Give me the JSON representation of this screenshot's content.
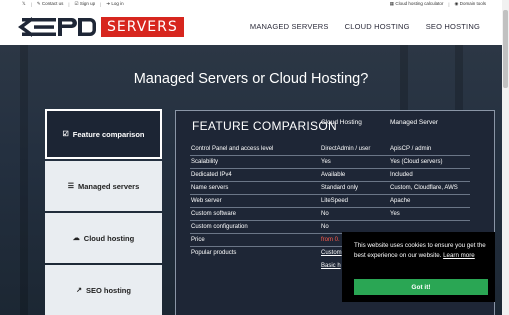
{
  "topbar": {
    "twitter_icon": "twitter-icon",
    "contact": "Contact us",
    "signup": "Sign up",
    "login": "Log in",
    "calculator": "Cloud hosting calculator",
    "domain_tools": "Domain tools"
  },
  "brand": {
    "servers_label": "SERVERS",
    "accent": "#d7261e"
  },
  "nav": {
    "items": [
      "MANAGED SERVERS",
      "CLOUD HOSTING",
      "SEO HOSTING"
    ]
  },
  "hero": {
    "title": "Managed Servers or Cloud Hosting?"
  },
  "tabs": [
    {
      "label": "Feature comparison",
      "icon": "checkbox-icon"
    },
    {
      "label": "Managed servers",
      "icon": "list-icon"
    },
    {
      "label": "Cloud hosting",
      "icon": "cloud-icon"
    },
    {
      "label": "SEO hosting",
      "icon": "chart-icon"
    }
  ],
  "comparison": {
    "title": "FEATURE COMPARISON",
    "columns": [
      "Cloud Hosting",
      "Managed Server"
    ],
    "rows": [
      [
        "Control Panel and access level",
        "DirectAdmin / user",
        "ApisCP / admin"
      ],
      [
        "Scalability",
        "Yes",
        "Yes (Cloud servers)"
      ],
      [
        "Dedicated IPv4",
        "Available",
        "Included"
      ],
      [
        "Name servers",
        "Standard only",
        "Custom, Cloudflare, AWS"
      ],
      [
        "Web server",
        "LiteSpeed",
        "Apache"
      ],
      [
        "Custom software",
        "No",
        "Yes"
      ],
      [
        "Custom configuration",
        "No",
        ""
      ],
      [
        "Price",
        "from 0.",
        ""
      ],
      [
        "Popular products",
        "Custom",
        ""
      ],
      [
        "",
        "Basic h",
        ""
      ]
    ]
  },
  "cookie": {
    "message": "This website uses cookies to ensure you get the best experience on our website.",
    "learn_more": "Learn more",
    "button": "Got it!"
  }
}
